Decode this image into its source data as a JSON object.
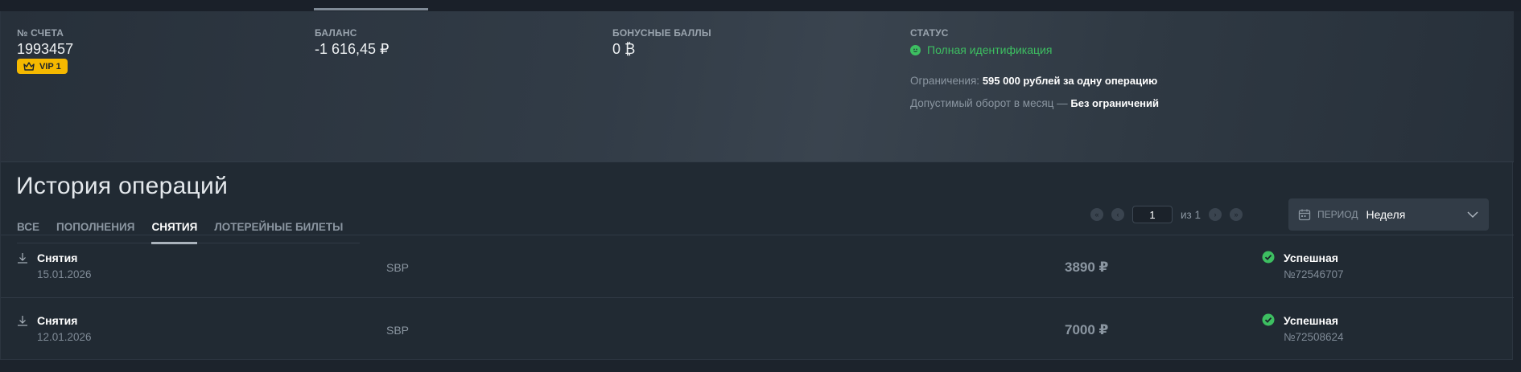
{
  "account": {
    "number_label": "№ СЧЕТА",
    "number": "1993457",
    "vip": "VIP 1",
    "balance_label": "БАЛАНС",
    "balance": "-1 616,45 ₽",
    "bonus_label": "БОНУСНЫЕ БАЛЛЫ",
    "bonus": "0 ₿",
    "status_label": "СТАТУС",
    "status": "Полная идентификация",
    "limit_label": "Ограничения:",
    "limit_value": "595 000 рублей за одну операцию",
    "turnover_label": "Допустимый оборот в месяц —",
    "turnover_value": "Без ограничений"
  },
  "history": {
    "title": "История операций",
    "tabs": [
      "ВСЕ",
      "ПОПОЛНЕНИЯ",
      "СНЯТИЯ",
      "ЛОТЕРЕЙНЫЕ БИЛЕТЫ"
    ],
    "active_tab": "СНЯТИЯ",
    "pager": {
      "page": "1",
      "of": "из 1"
    },
    "period": {
      "label": "ПЕРИОД",
      "value": "Неделя"
    }
  },
  "operations": [
    {
      "kind": "Снятия",
      "date": "15.01.2026",
      "method": "SBP",
      "amount": "3890 ₽",
      "status": "Успешная",
      "id": "№72546707"
    },
    {
      "kind": "Снятия",
      "date": "12.01.2026",
      "method": "SBP",
      "amount": "7000 ₽",
      "status": "Успешная",
      "id": "№72508624"
    }
  ],
  "colors": {
    "success": "#3dbf61",
    "vip": "#f5b800",
    "panel": "#212a33"
  }
}
